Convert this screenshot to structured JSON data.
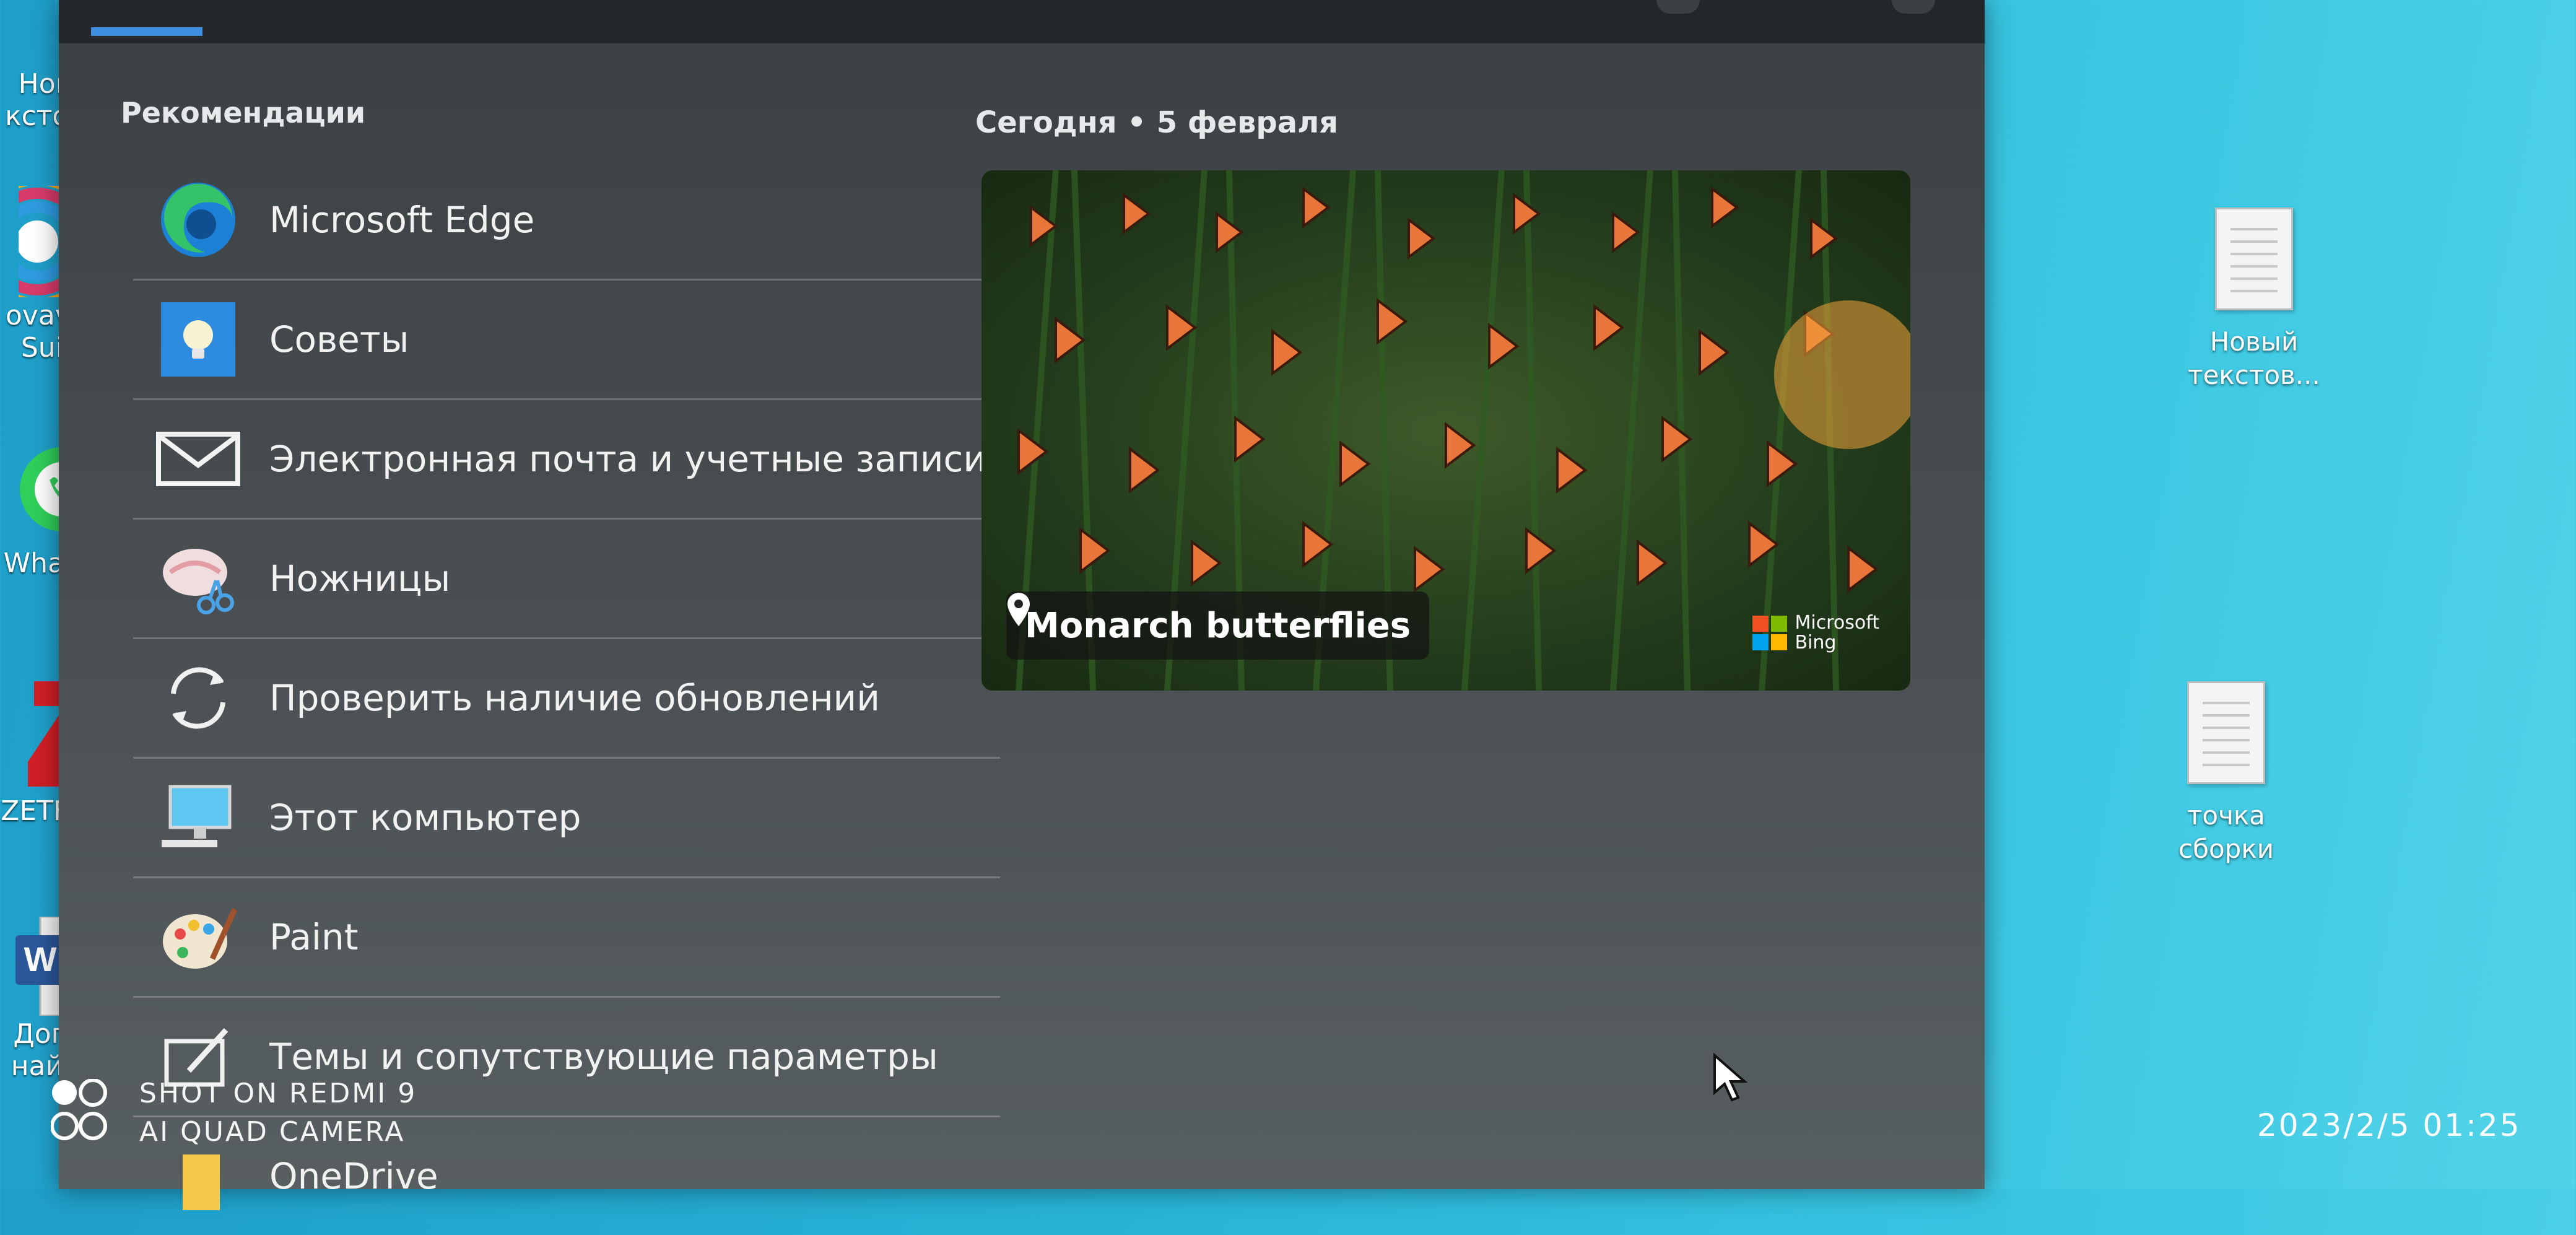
{
  "desktop": {
    "left_labels": [
      "Новы",
      "кстовы",
      "ovavi V",
      "Suite",
      "WhatsA",
      "ZETFLIX",
      "Догов",
      "найма"
    ],
    "right_files": [
      "Новый текстов...",
      "точка сборки"
    ]
  },
  "start_menu": {
    "recommendations_title": "Рекомендации",
    "items": [
      {
        "label": "Microsoft Edge",
        "icon": "edge-icon"
      },
      {
        "label": "Советы",
        "icon": "tips-icon"
      },
      {
        "label": "Электронная почта и учетные записи",
        "icon": "mail-icon"
      },
      {
        "label": "Ножницы",
        "icon": "snipping-tool-icon"
      },
      {
        "label": "Проверить наличие обновлений",
        "icon": "refresh-icon"
      },
      {
        "label": "Этот компьютер",
        "icon": "computer-icon"
      },
      {
        "label": "Paint",
        "icon": "paint-palette-icon"
      },
      {
        "label": "Темы и сопутствующие параметры",
        "icon": "themes-icon"
      },
      {
        "label": "OneDrive",
        "icon": "onedrive-icon"
      }
    ],
    "today_label": "Сегодня  •  5 февраля",
    "card": {
      "location": "Monarch butterflies",
      "brand_line1": "Microsoft",
      "brand_line2": "Bing"
    }
  },
  "watermark": {
    "line1": "SHOT ON REDMI 9",
    "line2": "AI QUAD CAMERA",
    "timestamp": "2023/2/5 01:25"
  },
  "colors": {
    "accent": "#3c8fe0",
    "desktop": "#27b3d6",
    "panel": "#454b4e"
  }
}
